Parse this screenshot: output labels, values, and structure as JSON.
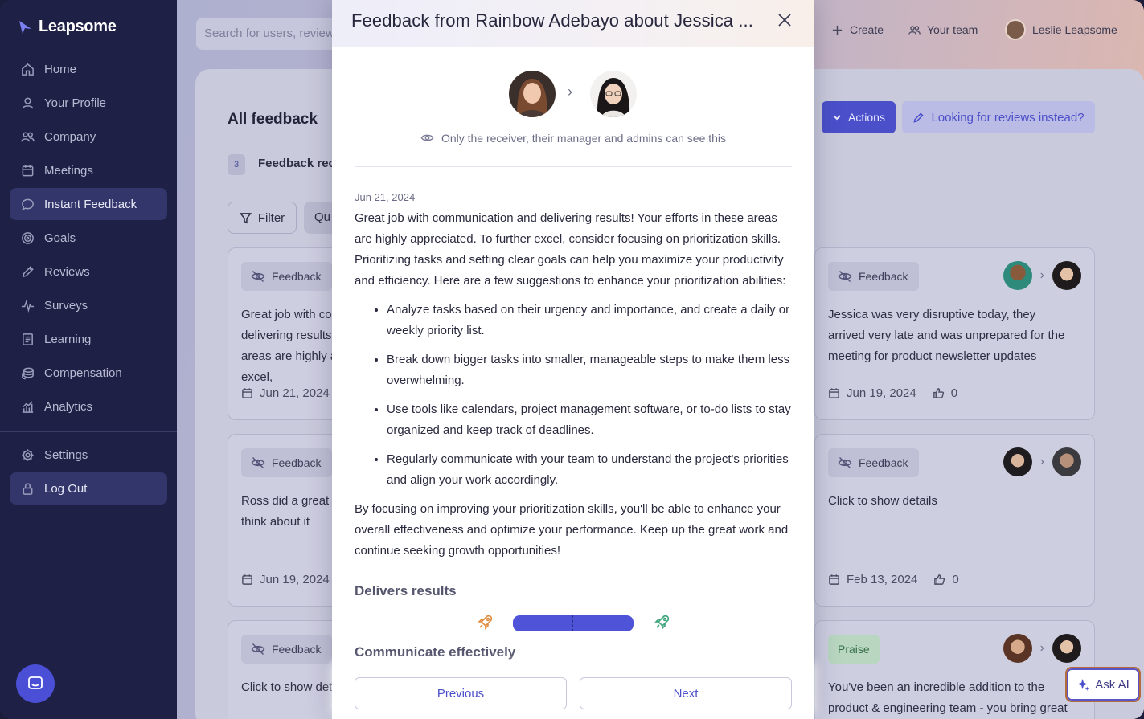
{
  "app": {
    "brand": "Leapsome"
  },
  "sidebar": {
    "items": [
      {
        "label": "Home",
        "icon": "home-icon"
      },
      {
        "label": "Your Profile",
        "icon": "user-icon"
      },
      {
        "label": "Company",
        "icon": "people-icon"
      },
      {
        "label": "Meetings",
        "icon": "calendar-icon"
      },
      {
        "label": "Instant Feedback",
        "icon": "chat-icon",
        "active": true
      },
      {
        "label": "Goals",
        "icon": "target-icon"
      },
      {
        "label": "Reviews",
        "icon": "pen-icon"
      },
      {
        "label": "Surveys",
        "icon": "pulse-icon"
      },
      {
        "label": "Learning",
        "icon": "book-icon"
      },
      {
        "label": "Compensation",
        "icon": "coins-icon"
      },
      {
        "label": "Analytics",
        "icon": "chart-icon"
      }
    ],
    "bottom": [
      {
        "label": "Settings",
        "icon": "gear-icon"
      },
      {
        "label": "Log Out",
        "icon": "lock-icon"
      }
    ]
  },
  "header": {
    "search_placeholder": "Search for users, reviews...",
    "create_label": "Create",
    "team_label": "Your team",
    "user_name": "Leslie Leapsome"
  },
  "page": {
    "title": "All feedback",
    "step_number": "3",
    "step_label": "Feedback received",
    "filter_label": "Filter",
    "quick_label": "Qu",
    "actions_label": "Actions",
    "reviews_link": "Looking for reviews instead?"
  },
  "cards": {
    "left": [
      {
        "chip": "Feedback",
        "text": "Great job with communication and delivering results! Your efforts in these areas are highly appreciated. To further excel,",
        "date": "Jun 21, 2024"
      },
      {
        "chip": "Feedback",
        "text": "Ross did a great job on the project, lets think about it",
        "date": "Jun 19, 2024"
      },
      {
        "chip": "Feedback",
        "text": "Click to show details"
      }
    ],
    "right": [
      {
        "chip": "Feedback",
        "text": "Jessica was very disruptive today, they arrived very late and was unprepared for the meeting for product newsletter updates",
        "date": "Jun 19, 2024",
        "likes": "0"
      },
      {
        "chip": "Feedback",
        "text": "Click to show details",
        "date": "Feb 13, 2024",
        "likes": "0"
      },
      {
        "chip": "Praise",
        "text": "You've been an incredible addition to the product & engineering team - you bring great"
      }
    ]
  },
  "modal": {
    "title": "Feedback from Rainbow Adebayo about Jessica ...",
    "visibility": "Only the receiver, their manager and admins can see this",
    "date": "Jun 21, 2024",
    "intro": "Great job with communication and delivering results! Your efforts in these areas are highly appreciated. To further excel, consider focusing on prioritization skills. Prioritizing tasks and setting clear goals can help you maximize your productivity and efficiency. Here are a few suggestions to enhance your prioritization abilities:",
    "bullets": [
      "Analyze tasks based on their urgency and importance, and create a daily or weekly priority list.",
      "Break down bigger tasks into smaller, manageable steps to make them less overwhelming.",
      "Use tools like calendars, project management software, or to-do lists to stay organized and keep track of deadlines.",
      "Regularly communicate with your team to understand the project's priorities and align your work accordingly."
    ],
    "outro": "By focusing on improving your prioritization skills, you'll be able to enhance your overall effectiveness and optimize your performance. Keep up the great work and continue seeking growth opportunities!",
    "skills": [
      {
        "name": "Delivers results",
        "level_fraction": 1.0
      },
      {
        "name": "Communicate effectively"
      }
    ],
    "previous_label": "Previous",
    "next_label": "Next"
  },
  "ask_ai_label": "Ask AI",
  "colors": {
    "accent": "#4f53d8",
    "sidebar": "#1f2045",
    "praise": "#37704a"
  }
}
